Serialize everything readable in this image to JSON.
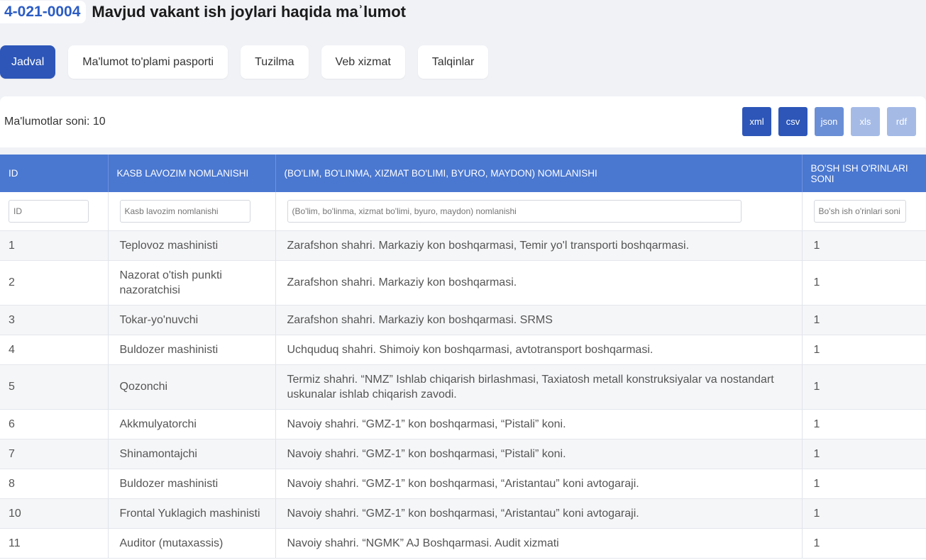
{
  "header": {
    "code": "4-021-0004",
    "title": "Mavjud vakant ish joylari haqida maʾlumot"
  },
  "tabs": [
    {
      "label": "Jadval",
      "active": true
    },
    {
      "label": "Ma'lumot to'plami pasporti",
      "active": false
    },
    {
      "label": "Tuzilma",
      "active": false
    },
    {
      "label": "Veb xizmat",
      "active": false
    },
    {
      "label": "Talqinlar",
      "active": false
    }
  ],
  "summary": {
    "count_text": "Ma'lumotlar soni: 10"
  },
  "exports": [
    {
      "label": "xml",
      "color": "#2d56b8"
    },
    {
      "label": "csv",
      "color": "#2d56b8"
    },
    {
      "label": "json",
      "color": "#6b8fd6"
    },
    {
      "label": "xls",
      "color": "#a5bbe6"
    },
    {
      "label": "rdf",
      "color": "#a5bbe6"
    }
  ],
  "table": {
    "columns": [
      "ID",
      "KASB LAVOZIM NOMLANISHI",
      "(BO'LIM, BO'LINMA, XIZMAT BO'LIMI, BYURO, MAYDON) NOMLANISHI",
      "BO'SH ISH O'RINLARI SONI"
    ],
    "filter_placeholders": [
      "ID",
      "Kasb lavozim nomlanishi",
      "(Bo'lim, bo'linma, xizmat bo'limi, byuro, maydon) nomlanishi",
      "Bo'sh ish o'rinlari soni"
    ],
    "rows": [
      [
        "1",
        "Teplovoz mashinisti",
        "Zarafshon shahri. Markaziy kon boshqarmasi, Temir yo'l transporti boshqarmasi.",
        "1"
      ],
      [
        "2",
        "Nazorat o'tish punkti nazoratchisi",
        "Zarafshon shahri. Markaziy kon boshqarmasi.",
        "1"
      ],
      [
        "3",
        "Tokar-yo'nuvchi",
        "Zarafshon shahri. Markaziy kon boshqarmasi. SRMS",
        "1"
      ],
      [
        "4",
        "Buldozer mashinisti",
        "Uchquduq shahri. Shimoiy kon boshqarmasi, avtotransport boshqarmasi.",
        "1"
      ],
      [
        "5",
        "Qozonchi",
        "Termiz shahri. “NMZ” Ishlab chiqarish birlashmasi, Taxiatosh metall konstruksiyalar va nostandart uskunalar ishlab chiqarish zavodi.",
        "1"
      ],
      [
        "6",
        "Akkmulyatorchi",
        "Navoiy shahri. “GMZ-1” kon boshqarmasi, “Pistali” koni.",
        "1"
      ],
      [
        "7",
        "Shinamontajchi",
        "Navoiy shahri. “GMZ-1” kon boshqarmasi, “Pistali” koni.",
        "1"
      ],
      [
        "8",
        "Buldozer mashinisti",
        "Navoiy shahri. “GMZ-1” kon boshqarmasi, “Aristantau” koni avtogaraji.",
        "1"
      ],
      [
        "10",
        "Frontal Yuklagich mashinisti",
        "Navoiy shahri. “GMZ-1” kon boshqarmasi, “Aristantau” koni avtogaraji.",
        "1"
      ],
      [
        "11",
        "Auditor (mutaxassis)",
        "Navoiy shahri. “NGMK” AJ Boshqarmasi. Audit xizmati",
        "1"
      ]
    ]
  }
}
